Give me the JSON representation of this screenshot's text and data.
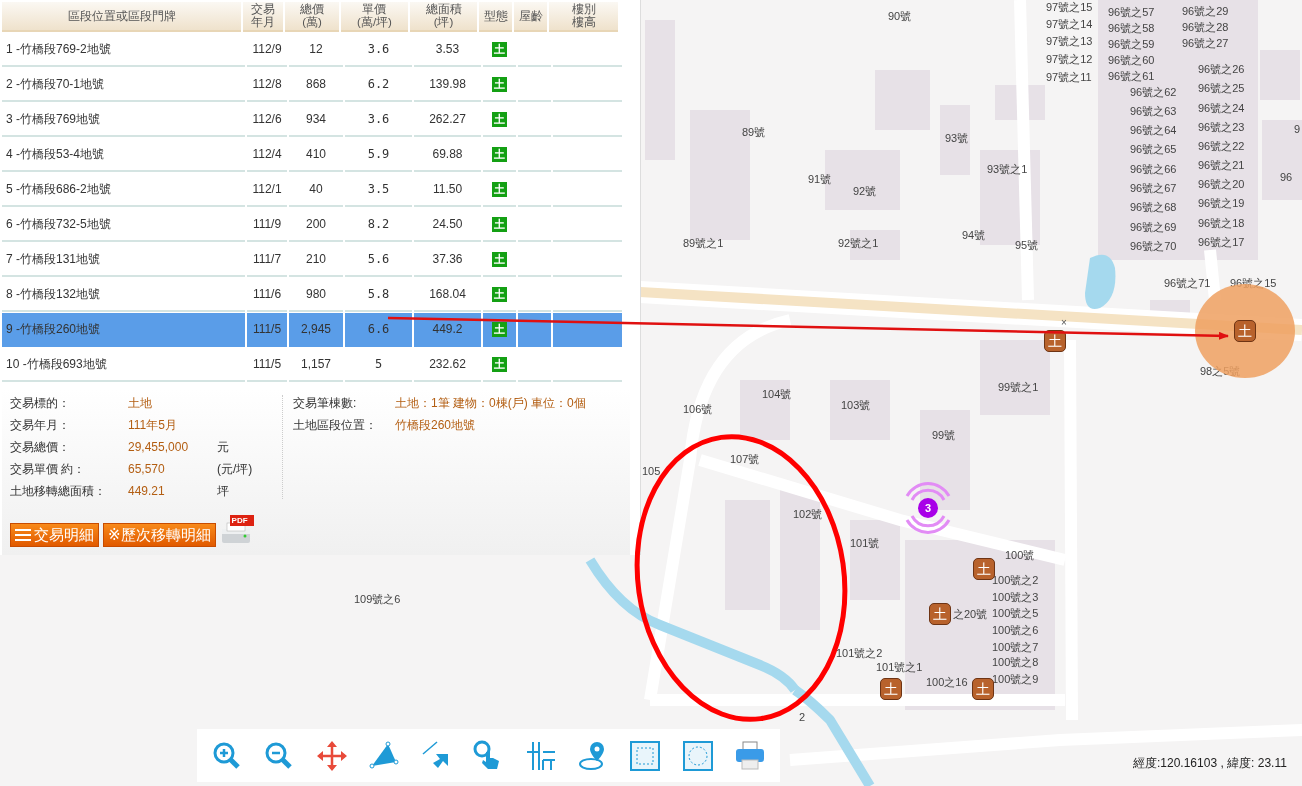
{
  "table": {
    "columns": [
      [
        "區段位置或區段門牌"
      ],
      [
        "交易",
        "年月"
      ],
      [
        "總價",
        "(萬)"
      ],
      [
        "單價",
        "(萬/坪)"
      ],
      [
        "總面積",
        "(坪)"
      ],
      [
        "型態"
      ],
      [
        "屋齡"
      ],
      [
        "樓別",
        "樓高"
      ]
    ],
    "rows": [
      {
        "name": "1 -竹橋段769-2地號",
        "month": "112/9",
        "total": "12",
        "unit": "3.6",
        "area": "3.53",
        "type": "土",
        "selected": false
      },
      {
        "name": "2 -竹橋段70-1地號",
        "month": "112/8",
        "total": "868",
        "unit": "6.2",
        "area": "139.98",
        "type": "土",
        "selected": false
      },
      {
        "name": "3 -竹橋段769地號",
        "month": "112/6",
        "total": "934",
        "unit": "3.6",
        "area": "262.27",
        "type": "土",
        "selected": false
      },
      {
        "name": "4 -竹橋段53-4地號",
        "month": "112/4",
        "total": "410",
        "unit": "5.9",
        "area": "69.88",
        "type": "土",
        "selected": false
      },
      {
        "name": "5 -竹橋段686-2地號",
        "month": "112/1",
        "total": "40",
        "unit": "3.5",
        "area": "11.50",
        "type": "土",
        "selected": false
      },
      {
        "name": "6 -竹橋段732-5地號",
        "month": "111/9",
        "total": "200",
        "unit": "8.2",
        "area": "24.50",
        "type": "土",
        "selected": false
      },
      {
        "name": "7 -竹橋段131地號",
        "month": "111/7",
        "total": "210",
        "unit": "5.6",
        "area": "37.36",
        "type": "土",
        "selected": false
      },
      {
        "name": "8 -竹橋段132地號",
        "month": "111/6",
        "total": "980",
        "unit": "5.8",
        "area": "168.04",
        "type": "土",
        "selected": false
      },
      {
        "name": "9 -竹橋段260地號",
        "month": "111/5",
        "total": "2,945",
        "unit": "6.6",
        "area": "449.2",
        "type": "土",
        "selected": true
      },
      {
        "name": "10 -竹橋段693地號",
        "month": "111/5",
        "total": "1,157",
        "unit": "5",
        "area": "232.62",
        "type": "土",
        "selected": false
      }
    ]
  },
  "details": {
    "left": [
      {
        "label": "交易標的：",
        "value": "土地"
      },
      {
        "label": "交易年月：",
        "value": "111年5月"
      },
      {
        "label": "交易總價：",
        "value": "29,455,000",
        "unit": "元"
      },
      {
        "label": "交易單價 約：",
        "value": "65,570",
        "unit": "(元/坪)"
      },
      {
        "label": "土地移轉總面積：",
        "value": "449.21",
        "unit": "坪"
      }
    ],
    "right": [
      {
        "label": "交易筆棟數:",
        "value": "土地：1筆 建物：0棟(戶) 車位：0個"
      },
      {
        "label": "土地區段位置：",
        "value": "竹橋段260地號"
      }
    ],
    "buttons": [
      {
        "kind": "list",
        "label": "交易明細"
      },
      {
        "kind": "plain",
        "label": "※歷次移轉明細"
      }
    ],
    "pdf_label": "PDF"
  },
  "map": {
    "labels": [
      "90號",
      "97號之15",
      "97號之14",
      "97號之13",
      "97號之12",
      "97號之11",
      "96號之57",
      "96號之58",
      "96號之59",
      "96號之60",
      "96號之61",
      "96號之29",
      "96號之28",
      "96號之27",
      "96號之62",
      "96號之63",
      "96號之64",
      "96號之65",
      "96號之66",
      "96號之67",
      "96號之68",
      "96號之69",
      "96號之70",
      "96號之26",
      "96號之25",
      "96號之24",
      "96號之23",
      "96號之22",
      "96號之21",
      "96號之20",
      "96號之19",
      "96號之18",
      "96號之17",
      "89號",
      "93號",
      "9",
      "91號",
      "92號",
      "93號之1",
      "96",
      "89號之1",
      "92號之1",
      "94號",
      "95號",
      "96號之71",
      "96號之15",
      "98之5號",
      "99號之1",
      "104號",
      "103號",
      "106號",
      "99號",
      "107號",
      "105",
      "102號",
      "101號",
      "100號",
      "100號之2",
      "100號之3",
      "100號之5",
      "100號之6",
      "100號之7",
      "100號之8",
      "100號之9",
      "之20號",
      "101號之2",
      "101號之1",
      "100之16",
      "109號之6",
      "2"
    ],
    "markers": [
      {
        "label": "土",
        "highlighted": false
      },
      {
        "label": "土",
        "highlighted": true
      },
      {
        "label": "土",
        "highlighted": false
      },
      {
        "label": "土",
        "highlighted": false
      },
      {
        "label": "土",
        "highlighted": false
      },
      {
        "label": "土",
        "highlighted": false
      }
    ],
    "close_mark": "×",
    "cluster": "3",
    "coordinates": "經度:120.16103 , 緯度: 23.11"
  },
  "toolbar": [
    {
      "kind": "zoom-in"
    },
    {
      "kind": "zoom-out"
    },
    {
      "kind": "pan"
    },
    {
      "kind": "area"
    },
    {
      "kind": "distance"
    },
    {
      "kind": "select"
    },
    {
      "kind": "grid"
    },
    {
      "kind": "locate"
    },
    {
      "kind": "frame"
    },
    {
      "kind": "frame-circle"
    },
    {
      "kind": "print"
    }
  ]
}
